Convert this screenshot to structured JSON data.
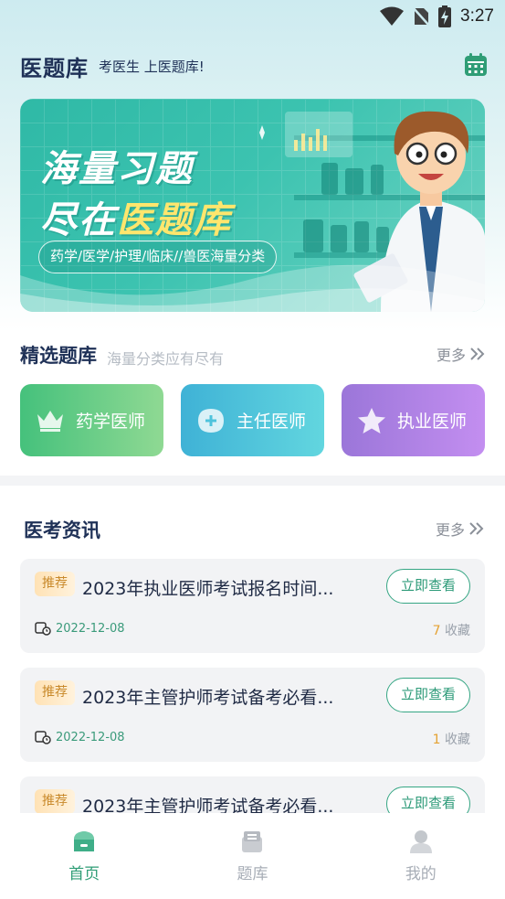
{
  "status": {
    "time": "3:27"
  },
  "header": {
    "logo": "医题库",
    "slogan": "考医生 上医题库!"
  },
  "banner": {
    "line1": "海量习题",
    "line2_prefix": "尽在",
    "line2_highlight": "医题库",
    "pill": "药学/医学/护理/临床//兽医海量分类"
  },
  "featured": {
    "title": "精选题库",
    "subtitle": "海量分类应有尽有",
    "more": "更多"
  },
  "categories": [
    {
      "label": "药学医师",
      "icon": "crown-icon"
    },
    {
      "label": "主任医师",
      "icon": "medical-plus-icon"
    },
    {
      "label": "执业医师",
      "icon": "star-icon"
    }
  ],
  "news": {
    "title": "医考资讯",
    "more": "更多",
    "items": [
      {
        "tag": "推荐",
        "title": "2023年执业医师考试报名时间...",
        "button": "立即查看",
        "date": "2022-12-08",
        "fav_count": "7",
        "fav_label": "收藏"
      },
      {
        "tag": "推荐",
        "title": "2023年主管护师考试备考必看...",
        "button": "立即查看",
        "date": "2022-12-08",
        "fav_count": "1",
        "fav_label": "收藏"
      },
      {
        "tag": "推荐",
        "title": "2023年主管护师考试备考必看...",
        "button": "立即查看",
        "date": "",
        "fav_count": "",
        "fav_label": ""
      }
    ]
  },
  "tabbar": [
    {
      "label": "首页",
      "active": true
    },
    {
      "label": "题库",
      "active": false
    },
    {
      "label": "我的",
      "active": false
    }
  ],
  "colors": {
    "accent": "#2f9d76",
    "navy": "#1f3157",
    "banner": "#3cc3b0"
  }
}
